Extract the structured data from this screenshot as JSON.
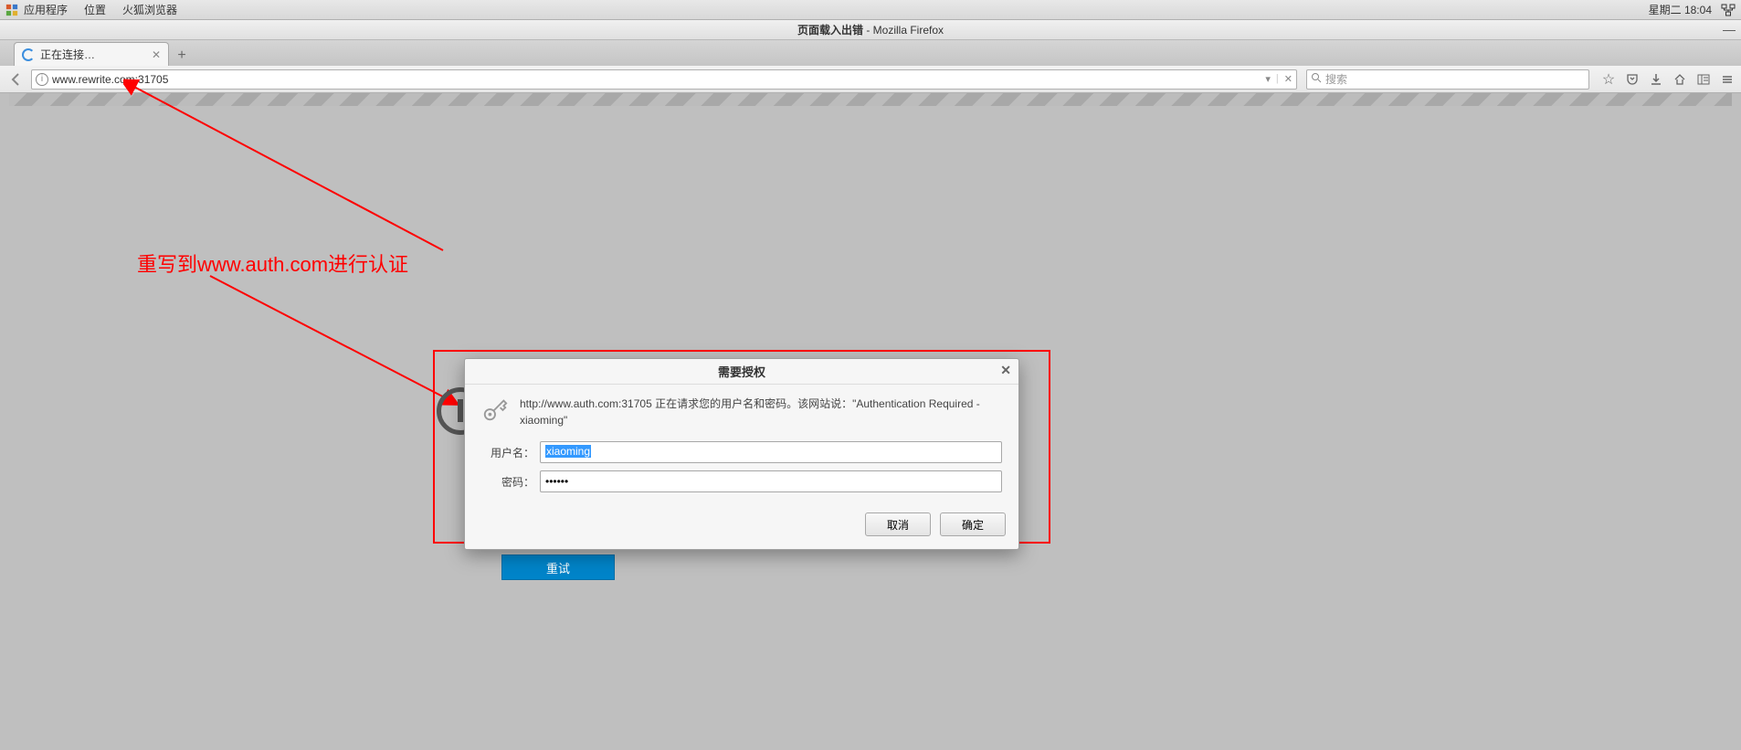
{
  "system_bar": {
    "menu_apps": "应用程序",
    "menu_places": "位置",
    "menu_browser": "火狐浏览器",
    "clock": "星期二 18:04"
  },
  "window": {
    "title_prefix": "页面载入出错",
    "title_sep": "  -  ",
    "title_app": "Mozilla Firefox"
  },
  "tab": {
    "label": "正在连接…"
  },
  "nav": {
    "url": "www.rewrite.com:31705",
    "search_placeholder": "搜索"
  },
  "annotation": {
    "text": "重写到www.auth.com进行认证"
  },
  "error_page": {
    "retry": "重试"
  },
  "dialog": {
    "title": "需要授权",
    "message": "http://www.auth.com:31705 正在请求您的用户名和密码。该网站说：\"Authentication Required - xiaoming\"",
    "username_label": "用户名：",
    "username_value": "xiaoming",
    "password_label": "密码：",
    "password_value": "••••••",
    "cancel": "取消",
    "ok": "确定"
  }
}
